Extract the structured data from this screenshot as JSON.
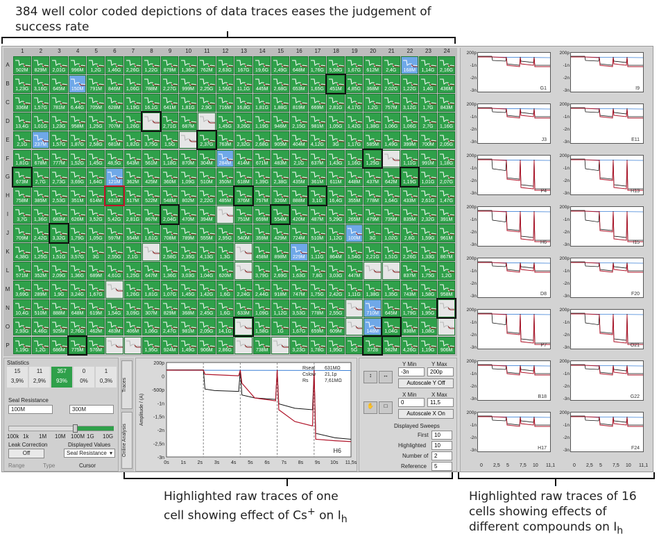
{
  "annotations": {
    "top": "384 well color coded depictions of data traces eases the judgement of success rate",
    "bottom_left_line1": "Highlighted raw traces of one",
    "bottom_left_line2": "cell showing effect of Cs",
    "bottom_left_sup": "+",
    "bottom_left_tail": " on I",
    "bottom_left_sub": "h",
    "bottom_right_line1": "Highlighted raw traces of 16",
    "bottom_right_line2": "cells showing effects of",
    "bottom_right_line3": "different compounds on I",
    "bottom_right_sub": "h"
  },
  "plate": {
    "columns": [
      "1",
      "2",
      "3",
      "4",
      "5",
      "6",
      "7",
      "8",
      "9",
      "10",
      "11",
      "12",
      "13",
      "14",
      "15",
      "16",
      "17",
      "18",
      "19",
      "20",
      "21",
      "22",
      "23",
      "24"
    ],
    "rows": [
      "A",
      "B",
      "C",
      "D",
      "E",
      "F",
      "G",
      "H",
      "I",
      "J",
      "K",
      "L",
      "M",
      "N",
      "O",
      "P"
    ],
    "values": [
      [
        "502M",
        "829M",
        "2,01G",
        "996M",
        "1,2G",
        "1,46G",
        "2,26G",
        "1,22G",
        "879M",
        "1,36G",
        "762M",
        "2,63G",
        "167G",
        "19,6G",
        "2,49G",
        "648M",
        "1,76G",
        "5,58G",
        "1,67G",
        "612M",
        "2,4G",
        "168M",
        "1,14G",
        "2,16G"
      ],
      [
        "1,23G",
        "3,16G",
        "645M",
        "150M",
        "791M",
        "846M",
        "1,06G",
        "788M",
        "2,27G",
        "999M",
        "2,25G",
        "1,56G",
        "11,1G",
        "445M",
        "2,68G",
        "653M",
        "1,65G",
        "451M",
        "4,85G",
        "368M",
        "2,02G",
        "1,22G",
        "1,4G",
        "436M"
      ],
      [
        "336M",
        "1,57G",
        "781M",
        "6,44G",
        "705M",
        "628M",
        "1,19G",
        "16,1G",
        "641M",
        "1,81G",
        "2,9G",
        "716M",
        "16,8G",
        "1,81G",
        "1,88G",
        "819M",
        "669M",
        "2,81G",
        "4,17G",
        "1,2G",
        "757M",
        "3,12G",
        "1,7G",
        "843M"
      ],
      [
        "13,4G",
        "1,01G",
        "1,23G",
        "958M",
        "1,25G",
        "707M",
        "1,26G",
        "",
        "2,71G",
        "687M",
        "",
        "1,45G",
        "3,26G",
        "1,19G",
        "946M",
        "2,15G",
        "981M",
        "1,05G",
        "1,42G",
        "1,38G",
        "1,06G",
        "1,06G",
        "2,7G",
        "1,16G"
      ],
      [
        "2,1G",
        "237M",
        "1,57G",
        "1,87G",
        "2,58G",
        "681M",
        "1,82G",
        "3,75G",
        "1,5G",
        "",
        "2,37G",
        "763M",
        "2,32G",
        "2,68G",
        "905M",
        "404M",
        "4,12G",
        "3G",
        "1,17G",
        "585M",
        "1,49G",
        "399M",
        "700M",
        "2,05G"
      ],
      [
        "1,81G",
        "678M",
        "777M",
        "1,52G",
        "1,45G",
        "48,5G",
        "643M",
        "561M",
        "1,18G",
        "870M",
        "304M",
        "284M",
        "414M",
        "671M",
        "483M",
        "2,1G",
        "637M",
        "1,43G",
        "1,16G",
        "1,25G",
        "",
        "1,11G",
        "991M",
        "1,18G"
      ],
      [
        "673M",
        "2,7G",
        "2,73G",
        "3,69G",
        "1,64G",
        "121M",
        "362M",
        "425M",
        "360M",
        "1,09G",
        "510M",
        "350M",
        "618M",
        "1,39G",
        "2,38G",
        "435M",
        "361M",
        "611M",
        "448M",
        "437M",
        "642M",
        "1,19G",
        "1,01G",
        "2,07G"
      ],
      [
        "758M",
        "385M",
        "2,53G",
        "351M",
        "614M",
        "631M",
        "517M",
        "522M",
        "548M",
        "802M",
        "2,22G",
        "485M",
        "376M",
        "757M",
        "326M",
        "888M",
        "3,1G",
        "16,4G",
        "355M",
        "778M",
        "1,64G",
        "433M",
        "2,61G",
        "1,47G"
      ],
      [
        "3,7G",
        "1,36G",
        "683M",
        "626M",
        "3,52G",
        "5,42G",
        "2,81G",
        "867M",
        "2,04G",
        "470M",
        "394M",
        "",
        "751M",
        "659M",
        "554M",
        "420M",
        "487M",
        "5,29G",
        "265M",
        "479M",
        "735M",
        "835M",
        "2,32G",
        "391M"
      ],
      [
        "709M",
        "2,42G",
        "3,32G",
        "1,79G",
        "1,05G",
        "597M",
        "554M",
        "1,61G",
        "708M",
        "789M",
        "555M",
        "2,95G",
        "540M",
        "359M",
        "429M",
        "724M",
        "510M",
        "1,12G",
        "100M",
        "3G",
        "1,02G",
        "2,6G",
        "1,59G",
        "961M"
      ],
      [
        "4,38G",
        "1,25G",
        "1,51G",
        "3,57G",
        "3G",
        "2,55G",
        "2,1G",
        "",
        "2,58G",
        "2,35G",
        "4,13G",
        "1,3G",
        "",
        "458M",
        "898M",
        "229M",
        "1,11G",
        "864M",
        "1,54G",
        "2,21G",
        "1,51G",
        "2,26G",
        "1,33G",
        "867M"
      ],
      [
        "571M",
        "352M",
        "2,09G",
        "1,36G",
        "689M",
        "4,61G",
        "1,25G",
        "647M",
        "1,36G",
        "3,03G",
        "1,04G",
        "620M",
        "",
        "3,79G",
        "2,69G",
        "1,63G",
        "7,8G",
        "3,03G",
        "447M",
        "",
        "",
        "837M",
        "1,75G",
        "1,2G"
      ],
      [
        "3,69G",
        "289M",
        "1,9G",
        "3,24G",
        "1,67G",
        "",
        "1,26G",
        "1,81G",
        "1,07G",
        "1,45G",
        "1,42G",
        "1,6G",
        "2,24G",
        "2,44G",
        "918M",
        "747M",
        "1,75G",
        "2,42G",
        "1,11G",
        "1,38G",
        "1,35G",
        "743M",
        "1,58G",
        "958M"
      ],
      [
        "10,4G",
        "510M",
        "888M",
        "648M",
        "619M",
        "1,54G",
        "3,09G",
        "307M",
        "829M",
        "368M",
        "2,45G",
        "1,6G",
        "633M",
        "1,09G",
        "1,12G",
        "3,53G",
        "778M",
        "2,55G",
        "",
        "710M",
        "645M",
        "1,79G",
        "1,95G",
        ""
      ],
      [
        "2,93G",
        "4,46G",
        "925M",
        "2,76G",
        "462M",
        "483M",
        "406M",
        "1,06G",
        "2,47G",
        "981M",
        "2,05G",
        "14,1G",
        "",
        "1,58G",
        "1G",
        "1,67G",
        "659M",
        "609M",
        "",
        "148M",
        "1,04G",
        "838M",
        "1,08G",
        ""
      ],
      [
        "1,19G",
        "1,2G",
        "686M",
        "775M",
        "576M",
        "",
        "",
        "1,95G",
        "924M",
        "1,49G",
        "906M",
        "2,86G",
        "",
        "738M",
        "",
        "3,23G",
        "1,78G",
        "1,95G",
        "5G",
        "3728",
        "582M",
        "4,26G",
        "1,19G",
        "906M"
      ]
    ],
    "blue_cells": [
      "B4",
      "E2",
      "F12",
      "G6",
      "J19",
      "K16",
      "N20",
      "O20",
      "A22"
    ],
    "gray_cells": [
      "D8",
      "D11",
      "E10",
      "F21",
      "I12",
      "K8",
      "K13",
      "L13",
      "L20",
      "L21",
      "M6",
      "N19",
      "N24",
      "O13",
      "O19",
      "O24",
      "P6",
      "P7",
      "P13",
      "P15"
    ],
    "highlighted_cells": [
      "G1",
      "J3",
      "P4",
      "D8",
      "H13",
      "I15",
      "E11",
      "F20",
      "G22",
      "H17",
      "I9",
      "O21",
      "O13",
      "B18",
      "N24",
      "P20"
    ],
    "highlight_red_cells": [
      "H6"
    ]
  },
  "statistics": {
    "title": "Statistics",
    "counts": [
      "15",
      "11",
      "357",
      "0",
      "1"
    ],
    "percents": [
      "3,9%",
      "2,9%",
      "93%",
      "0%",
      "0,3%"
    ],
    "seal_label": "Seal Resistance",
    "seal_min": "100M",
    "seal_max": "300M",
    "scale_ticks": [
      "100k",
      "1k",
      "1M",
      "10M",
      "100M",
      "1G",
      "10G"
    ],
    "leak_label": "Leak Correction",
    "leak_button": "Off",
    "displayed_values_label": "Displayed Values",
    "displayed_values": "Seal Resistance",
    "range_label": "Range",
    "type_label": "Type",
    "cursor_label": "Cursor"
  },
  "tabs": {
    "traces": "Traces",
    "online_analysis": "Online Analysis"
  },
  "main_plot": {
    "ylabel": "Amplitude / (A)",
    "y_ticks": [
      "200p",
      "0",
      "-500p",
      "-1n",
      "-1,5n",
      "-2n",
      "-2,5n",
      "-3n"
    ],
    "x_ticks": [
      "0s",
      "1s",
      "2s",
      "3s",
      "4s",
      "5s",
      "6s",
      "7s",
      "8s",
      "9s",
      "10s",
      "11,5s"
    ],
    "well_label": "H6",
    "legend": [
      {
        "name": "Rseal",
        "value": "631MΩ"
      },
      {
        "name": "Cslow",
        "value": "21,1p"
      },
      {
        "name": "Rs",
        "value": "7,61MΩ"
      }
    ],
    "colors": {
      "trace_black": "#111111",
      "trace_red": "#b0152a",
      "trace_blue": "#3a7fd6"
    }
  },
  "controls": {
    "ymin_label": "Y Min",
    "ymax_label": "Y Max",
    "ymin": "-3n",
    "ymax": "200p",
    "autoscale_y": "Autoscale Y Off",
    "xmin_label": "X Min",
    "xmax_label": "X Max",
    "xmin": "0",
    "xmax": "11,5",
    "autoscale_x": "Autoscale X On",
    "displayed_sweeps": "Displayed Sweeps",
    "first_label": "First",
    "first": "10",
    "highlighted_label": "Highlighted",
    "highlighted": "10",
    "number_label": "Number of",
    "number": "2",
    "reference_label": "Reference",
    "reference": "5"
  },
  "right_panel": {
    "y_ticks": [
      "200p",
      "-1n",
      "-2n",
      "-3n"
    ],
    "x_ticks": [
      "0",
      "2,5",
      "5",
      "7,5",
      "10",
      "11,1"
    ],
    "wells": [
      "G1",
      "I9",
      "J3",
      "E11",
      "P4",
      "H13",
      "H6",
      "I15",
      "D8",
      "F20",
      "P7",
      "O21",
      "B18",
      "G22",
      "H17",
      "F24"
    ]
  }
}
